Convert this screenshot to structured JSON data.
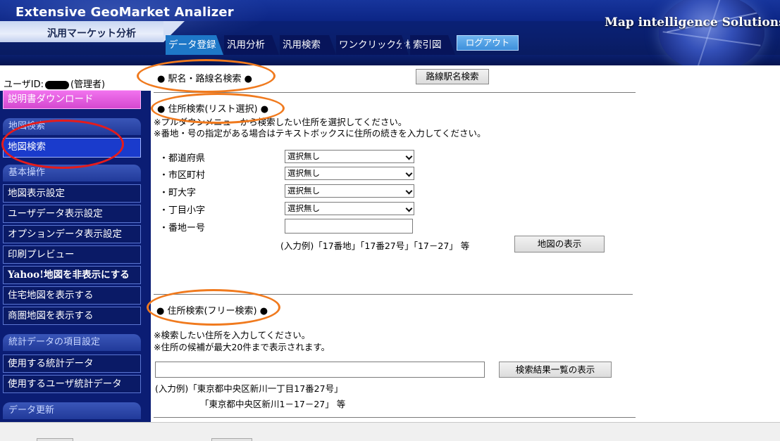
{
  "header": {
    "app_title": "Extensive GeoMarket Analizer",
    "app_subtitle": "汎用マーケット分析",
    "brand": "Map intelligence Solutions"
  },
  "tabs": [
    {
      "label": "データ登録",
      "active": true
    },
    {
      "label": "汎用分析",
      "active": false
    },
    {
      "label": "汎用検索",
      "active": false
    },
    {
      "label": "ワンクリック分析",
      "active": false
    },
    {
      "label": "索引図",
      "active": false
    }
  ],
  "logout_label": "ログアウト",
  "sidebar": {
    "user_prefix": "ユーザID:",
    "user_role": "(管理者)",
    "manual_download": "説明書ダウンロード",
    "section_map_search": "地図検索",
    "map_search_item": "地図検索",
    "section_basic": "基本操作",
    "basic_items": [
      "地図表示設定",
      "ユーザデータ表示設定",
      "オプションデータ表示設定",
      "印刷プレビュー",
      "Yahoo!地図を非表示にする",
      "住宅地図を表示する",
      "商圏地図を表示する"
    ],
    "section_stats": "統計データの項目設定",
    "stats_items": [
      "使用する統計データ",
      "使用するユーザ統計データ"
    ],
    "section_update": "データ更新"
  },
  "main": {
    "station_section_title": "● 駅名・路線名検索 ●",
    "station_search_button": "路線駅名検索",
    "address_list_title": "● 住所検索(リスト選択) ●",
    "address_list_note1": "※プルダウンメニューから検索したい住所を選択してください。",
    "address_list_note2": "※番地・号の指定がある場合はテキストボックスに住所の続きを入力してください。",
    "fields": [
      {
        "label": "・都道府県",
        "value": "選択無し"
      },
      {
        "label": "・市区町村",
        "value": "選択無し"
      },
      {
        "label": "・町大字",
        "value": "選択無し"
      },
      {
        "label": "・丁目小字",
        "value": "選択無し"
      }
    ],
    "banchi_label": "・番地ー号",
    "banchi_value": "",
    "banchi_example": "(入力例)「17番地」「17番27号」「17－27」 等",
    "map_display_button": "地図の表示",
    "free_search_title": "● 住所検索(フリー検索) ●",
    "free_note1": "※検索したい住所を入力してください。",
    "free_note2": "※住所の候補が最大20件まで表示されます。",
    "free_input_value": "",
    "search_results_button": "検索結果一覧の表示",
    "free_example1": "(入力例)「東京都中央区新川一丁目17番27号」",
    "free_example2": "「東京都中央区新川1－17－27」 等"
  },
  "colors": {
    "header_blue": "#0b2380",
    "sidebar_blue": "#0b1d74",
    "active_tab": "#1e78c8",
    "logout_blue": "#3d8fdc",
    "magenta": "#d548d0",
    "orange_annotation": "#f07a1e",
    "red_annotation": "#e51b1b"
  }
}
